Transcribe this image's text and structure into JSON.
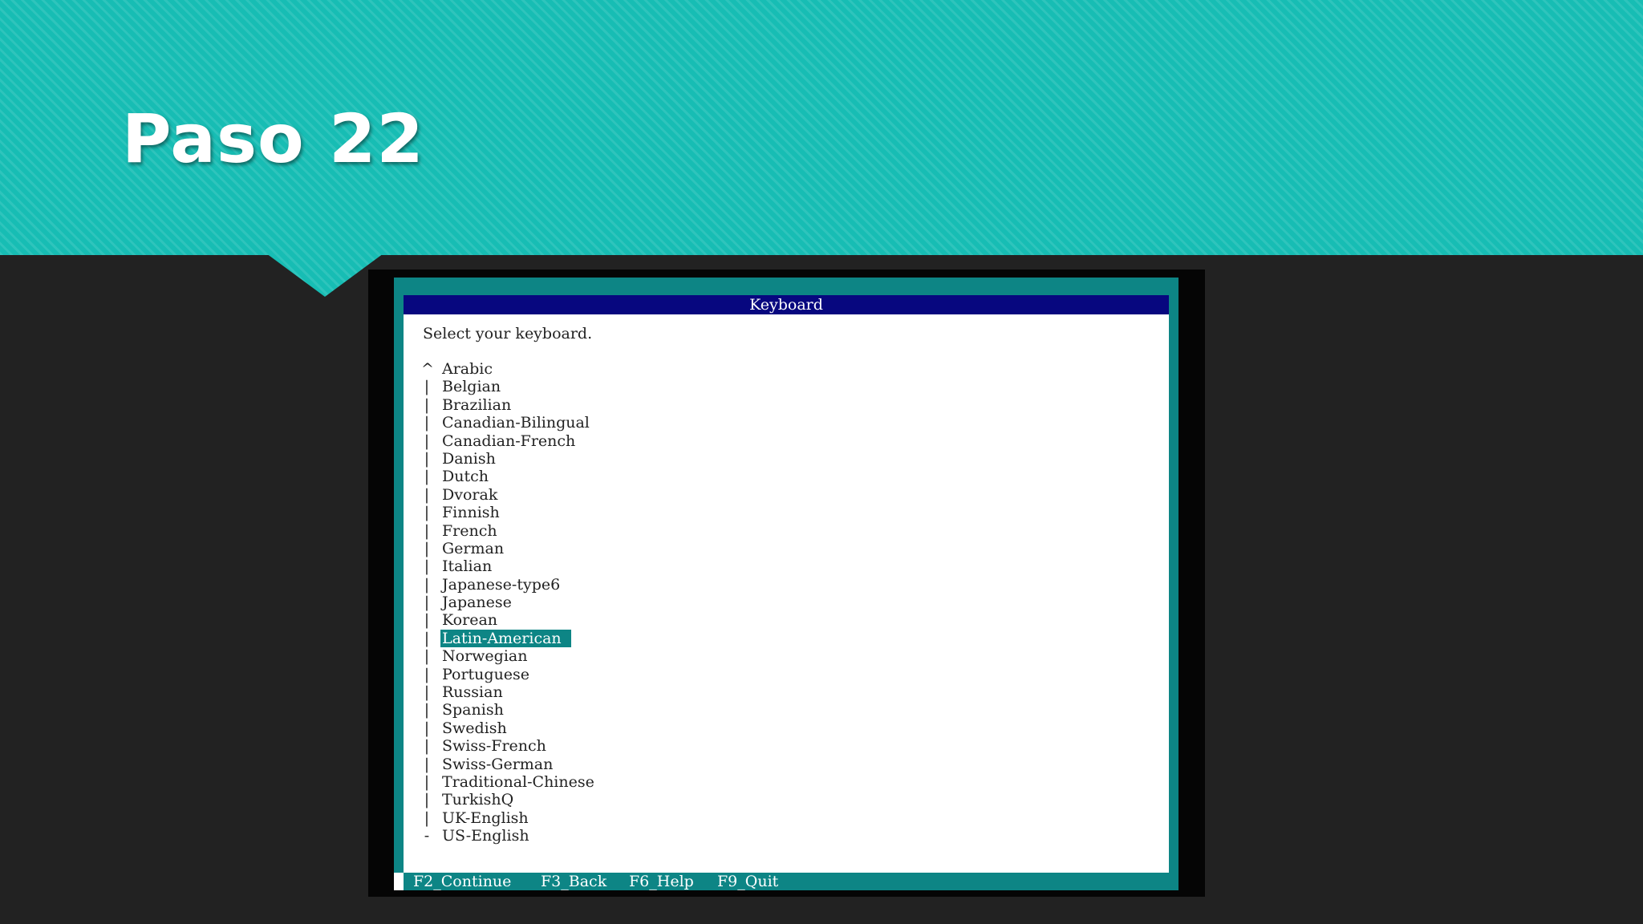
{
  "slide": {
    "title": "Paso 22"
  },
  "colors": {
    "banner": "#17bdb4",
    "background": "#222222",
    "dialog_header": "#07077f",
    "terminal_teal": "#0d8585",
    "selection": "#0d8585"
  },
  "dialog": {
    "title": "Keyboard",
    "prompt": "Select your keyboard.",
    "items": [
      {
        "marker": "^",
        "label": "Arabic"
      },
      {
        "marker": "|",
        "label": "Belgian"
      },
      {
        "marker": "|",
        "label": "Brazilian"
      },
      {
        "marker": "|",
        "label": "Canadian-Bilingual"
      },
      {
        "marker": "|",
        "label": "Canadian-French"
      },
      {
        "marker": "|",
        "label": "Danish"
      },
      {
        "marker": "|",
        "label": "Dutch"
      },
      {
        "marker": "|",
        "label": "Dvorak"
      },
      {
        "marker": "|",
        "label": "Finnish"
      },
      {
        "marker": "|",
        "label": "French"
      },
      {
        "marker": "|",
        "label": "German"
      },
      {
        "marker": "|",
        "label": "Italian"
      },
      {
        "marker": "|",
        "label": "Japanese-type6"
      },
      {
        "marker": "|",
        "label": "Japanese"
      },
      {
        "marker": "|",
        "label": "Korean"
      },
      {
        "marker": "|",
        "label": "Latin-American",
        "selected": true
      },
      {
        "marker": "|",
        "label": "Norwegian"
      },
      {
        "marker": "|",
        "label": "Portuguese"
      },
      {
        "marker": "|",
        "label": "Russian"
      },
      {
        "marker": "|",
        "label": "Spanish"
      },
      {
        "marker": "|",
        "label": "Swedish"
      },
      {
        "marker": "|",
        "label": "Swiss-French"
      },
      {
        "marker": "|",
        "label": "Swiss-German"
      },
      {
        "marker": "|",
        "label": "Traditional-Chinese"
      },
      {
        "marker": "|",
        "label": "TurkishQ"
      },
      {
        "marker": "|",
        "label": "UK-English"
      },
      {
        "marker": "-",
        "label": "US-English"
      }
    ],
    "function_keys": [
      "F2_Continue",
      "F3_Back",
      "F6_Help",
      "F9_Quit"
    ]
  }
}
